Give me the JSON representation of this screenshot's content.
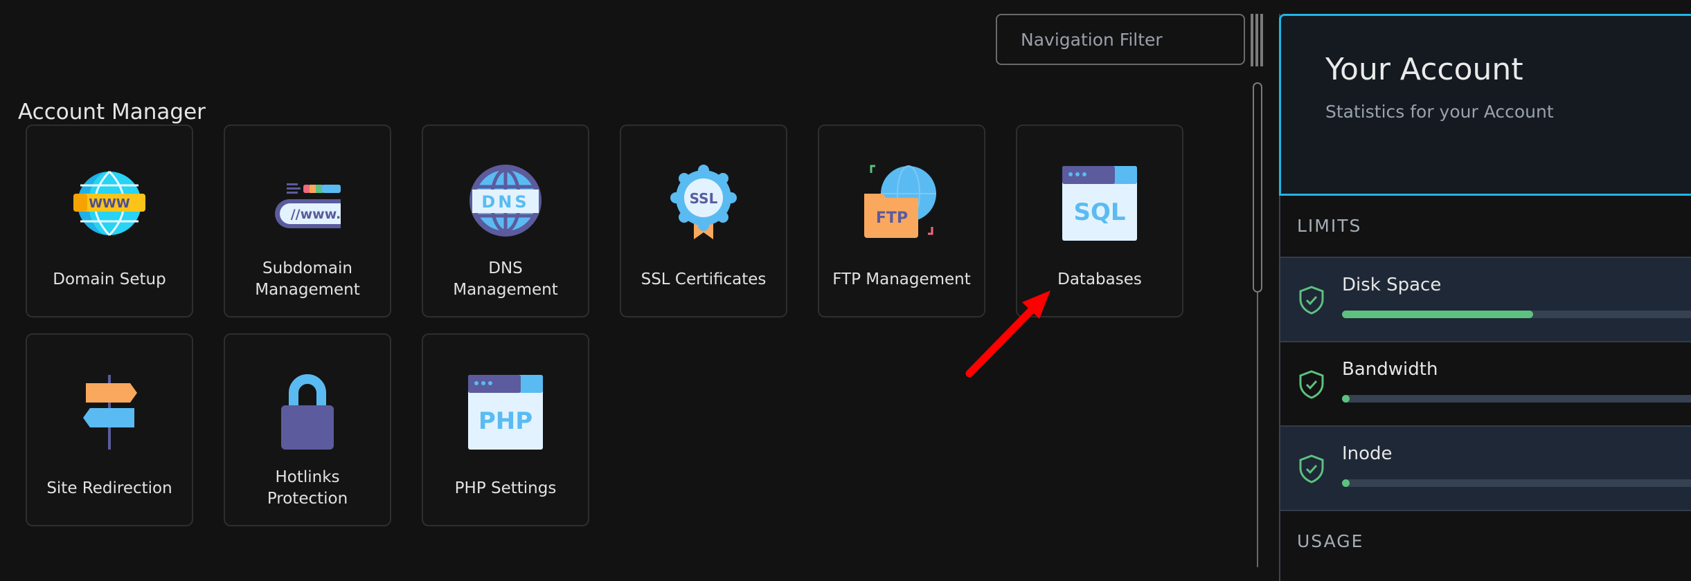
{
  "navigation_filter": {
    "placeholder": "Navigation Filter",
    "value": ""
  },
  "section": {
    "title": "Account Manager"
  },
  "cards": [
    {
      "label": "Domain Setup",
      "icon": "globe-www-icon"
    },
    {
      "label": "Subdomain Management",
      "icon": "url-bar-icon"
    },
    {
      "label": "DNS Management",
      "icon": "dns-globe-icon"
    },
    {
      "label": "SSL Certificates",
      "icon": "ssl-badge-icon"
    },
    {
      "label": "FTP Management",
      "icon": "ftp-folder-icon"
    },
    {
      "label": "Databases",
      "icon": "sql-window-icon"
    },
    {
      "label": "Site Redirection",
      "icon": "signpost-icon"
    },
    {
      "label": "Hotlinks Protection",
      "icon": "padlock-icon"
    },
    {
      "label": "PHP Settings",
      "icon": "php-window-icon"
    }
  ],
  "account_panel": {
    "title": "Your Account",
    "subtitle": "Statistics for your Account",
    "limits_heading": "LIMITS",
    "usage_heading": "USAGE",
    "limits": [
      {
        "label": "Disk Space",
        "status": "ok",
        "fill_percent": 52
      },
      {
        "label": "Bandwidth",
        "status": "ok",
        "fill_percent": 1
      },
      {
        "label": "Inode",
        "status": "ok",
        "fill_percent": 1
      }
    ]
  },
  "annotation": {
    "type": "red-arrow",
    "points_to": "Databases",
    "color": "#ff0000"
  },
  "colors": {
    "accent": "#1fb5e8",
    "progress_fill": "#5dc180",
    "progress_track": "#364152",
    "status_ok": "#5dc180"
  }
}
